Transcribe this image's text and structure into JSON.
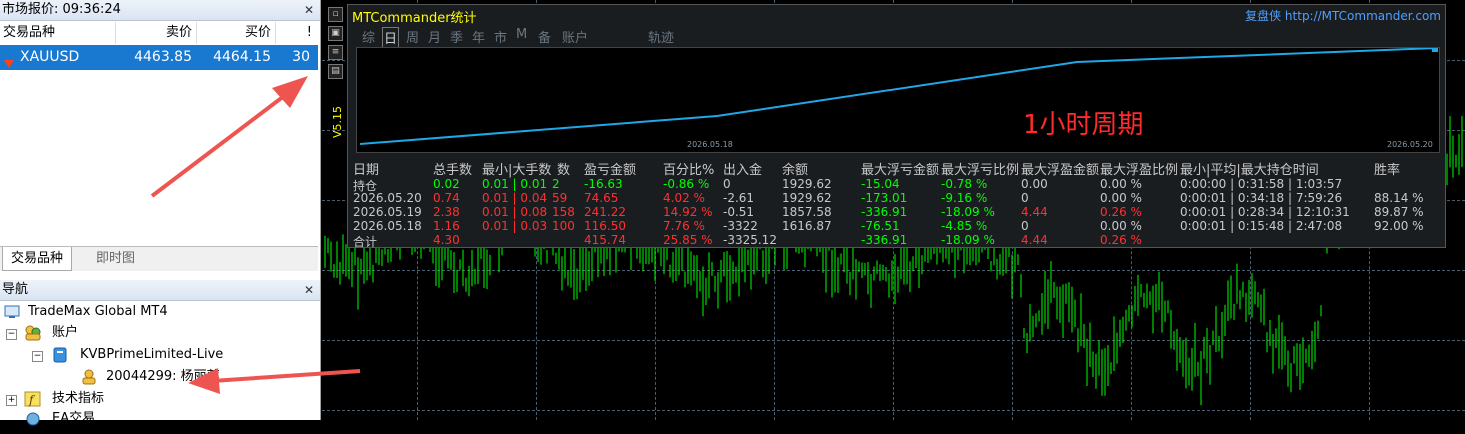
{
  "market_watch": {
    "title": "市场报价: 09:36:24",
    "columns": [
      "交易品种",
      "卖价",
      "买价",
      "!"
    ],
    "rows": [
      {
        "symbol": "XAUUSD",
        "bid": "4463.85",
        "ask": "4464.15",
        "spread": "30"
      }
    ],
    "tabs": [
      "交易品种",
      "即时图"
    ]
  },
  "navigator": {
    "title": "导航",
    "items": {
      "broker": "TradeMax Global MT4",
      "accounts": "账户",
      "account_server": "KVBPrimeLimited-Live",
      "account_number": "20044299: 杨丽萍",
      "indicators": "技术指标",
      "ea": "EA交易"
    }
  },
  "chart": {
    "side_label": "V5.15",
    "stat_window": {
      "title": "MTCommander统计",
      "right_label": "复盘侠",
      "url": "http://MTCommander.com",
      "tabs": [
        "综",
        "日",
        "周",
        "月",
        "季",
        "年",
        "市",
        "M",
        "备",
        "账户",
        "轨迹"
      ],
      "annotation": "1小时周期",
      "date_start": "2026.05.18",
      "date_end": "2026.05.20",
      "headers": [
        "日期",
        "总手数",
        "最小|大手数",
        "数",
        "盈亏金额",
        "百分比%",
        "出入金",
        "余额",
        "最大浮亏金额",
        "最大浮亏比例",
        "最大浮盈金额",
        "最大浮盈比例",
        "最小|平均|最大持仓时间",
        "胜率"
      ],
      "rows": [
        {
          "date": "持仓",
          "lots": "0.02",
          "minmax": "0.01 | 0.01",
          "count": "2",
          "pnl": "-16.63",
          "pct": "-0.86 %",
          "io": "0",
          "balance": "1929.62",
          "maxloss": "-15.04",
          "maxloss_pct": "-0.78 %",
          "maxgain": "0.00",
          "maxgain_pct": "0.00 %",
          "hold": "0:00:00 | 0:31:58 | 1:03:57",
          "win": ""
        },
        {
          "date": "2026.05.20",
          "lots": "0.74",
          "minmax": "0.01 | 0.04",
          "count": "59",
          "pnl": "74.65",
          "pct": "4.02 %",
          "io": "-2.61",
          "balance": "1929.62",
          "maxloss": "-173.01",
          "maxloss_pct": "-9.16 %",
          "maxgain": "0",
          "maxgain_pct": "0.00 %",
          "hold": "0:00:01 | 0:34:18 | 7:59:26",
          "win": "88.14 %"
        },
        {
          "date": "2026.05.19",
          "lots": "2.38",
          "minmax": "0.01 | 0.08",
          "count": "158",
          "pnl": "241.22",
          "pct": "14.92 %",
          "io": "-0.51",
          "balance": "1857.58",
          "maxloss": "-336.91",
          "maxloss_pct": "-18.09 %",
          "maxgain": "4.44",
          "maxgain_pct": "0.26 %",
          "hold": "0:00:01 | 0:28:34 | 12:10:31",
          "win": "89.87 %"
        },
        {
          "date": "2026.05.18",
          "lots": "1.16",
          "minmax": "0.01 | 0.03",
          "count": "100",
          "pnl": "116.50",
          "pct": "7.76 %",
          "io": "-3322",
          "balance": "1616.87",
          "maxloss": "-76.51",
          "maxloss_pct": "-4.85 %",
          "maxgain": "0",
          "maxgain_pct": "0.00 %",
          "hold": "0:00:01 | 0:15:48 | 2:47:08",
          "win": "92.00 %"
        },
        {
          "date": "合计",
          "lots": "4.30",
          "minmax": "",
          "count": "",
          "pnl": "415.74",
          "pct": "25.85 %",
          "io": "-3325.12",
          "balance": "",
          "maxloss": "-336.91",
          "maxloss_pct": "-18.09 %",
          "maxgain": "4.44",
          "maxgain_pct": "0.26 %",
          "hold": "",
          "win": ""
        }
      ]
    }
  },
  "colors": {
    "accent": "#1978d0",
    "up": "#00ff00",
    "down": "#ff3030",
    "curve": "#1fa8e8",
    "annotation": "#ff2a2a",
    "arrow": "#ef5550"
  }
}
